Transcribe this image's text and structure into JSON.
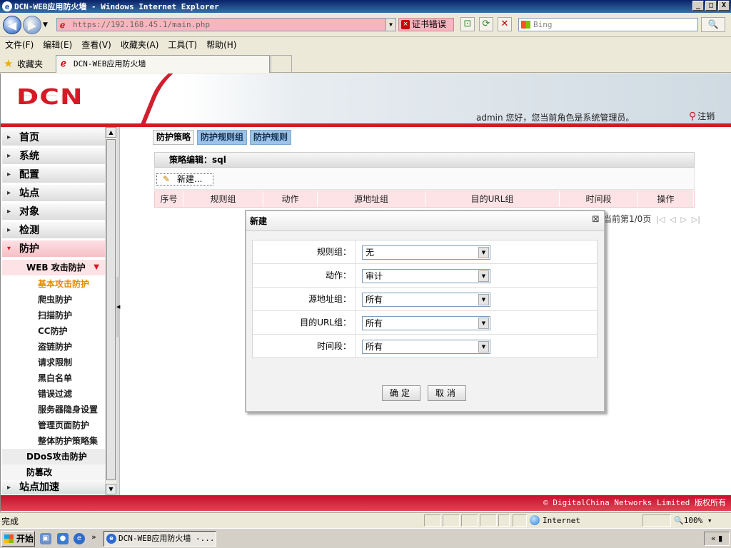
{
  "window": {
    "title": "DCN-WEB应用防火墙 - Windows Internet Explorer",
    "min": "_",
    "max": "□",
    "close": "X"
  },
  "addressbar": {
    "url": "https://192.168.45.1/main.php",
    "cert_error": "证书错误",
    "search_placeholder": "Bing",
    "search_icon": "🔍"
  },
  "menubar": {
    "items": [
      "文件(F)",
      "编辑(E)",
      "查看(V)",
      "收藏夹(A)",
      "工具(T)",
      "帮助(H)"
    ]
  },
  "favbar": {
    "favorites": "收藏夹",
    "tab_title": "DCN-WEB应用防火墙"
  },
  "header": {
    "logo": "DCN",
    "user_info": "admin 您好，您当前角色是系统管理员。",
    "logout": "注销"
  },
  "sidebar": {
    "top_items": [
      "首页",
      "系统",
      "配置",
      "站点",
      "对象",
      "检测",
      "防护"
    ],
    "sub_head": "WEB 攻击防护",
    "sub_items": [
      "基本攻击防护",
      "爬虫防护",
      "扫描防护",
      "CC防护",
      "盗链防护",
      "请求限制",
      "黑白名单",
      "错误过滤",
      "服务器隐身设置",
      "管理页面防护",
      "整体防护策略集"
    ],
    "active_sub": "基本攻击防护",
    "sub_head2": "DDoS攻击防护",
    "sub_head3": "防篡改",
    "bottom_item": "站点加速"
  },
  "main": {
    "tabs": [
      "防护策略",
      "防护规则组",
      "防护规则"
    ],
    "active_tab": "防护策略",
    "panel_title": "策略编辑：sql",
    "new_button": "新建...",
    "columns": [
      "序号",
      "规则组",
      "动作",
      "源地址组",
      "目的URL组",
      "时间段",
      "操作"
    ],
    "pager_text": "当前第1/0页"
  },
  "dialog": {
    "title": "新建",
    "fields": [
      {
        "label": "规则组：",
        "value": "无"
      },
      {
        "label": "动作：",
        "value": "审计"
      },
      {
        "label": "源地址组：",
        "value": "所有"
      },
      {
        "label": "目的URL组：",
        "value": "所有"
      },
      {
        "label": "时间段：",
        "value": "所有"
      }
    ],
    "ok": "确定",
    "cancel": "取消"
  },
  "footer": {
    "copyright": "© DigitalChina Networks Limited 版权所有"
  },
  "statusbar": {
    "status": "完成",
    "zone": "Internet",
    "zoom": "100%"
  },
  "taskbar": {
    "start": "开始",
    "task": "DCN-WEB应用防火墙 -..."
  },
  "colors": {
    "brand_red": "#d51a25",
    "tab_blue": "#9dc3e6",
    "header_pink": "#fde3e6",
    "active_orange": "#e88a00"
  }
}
